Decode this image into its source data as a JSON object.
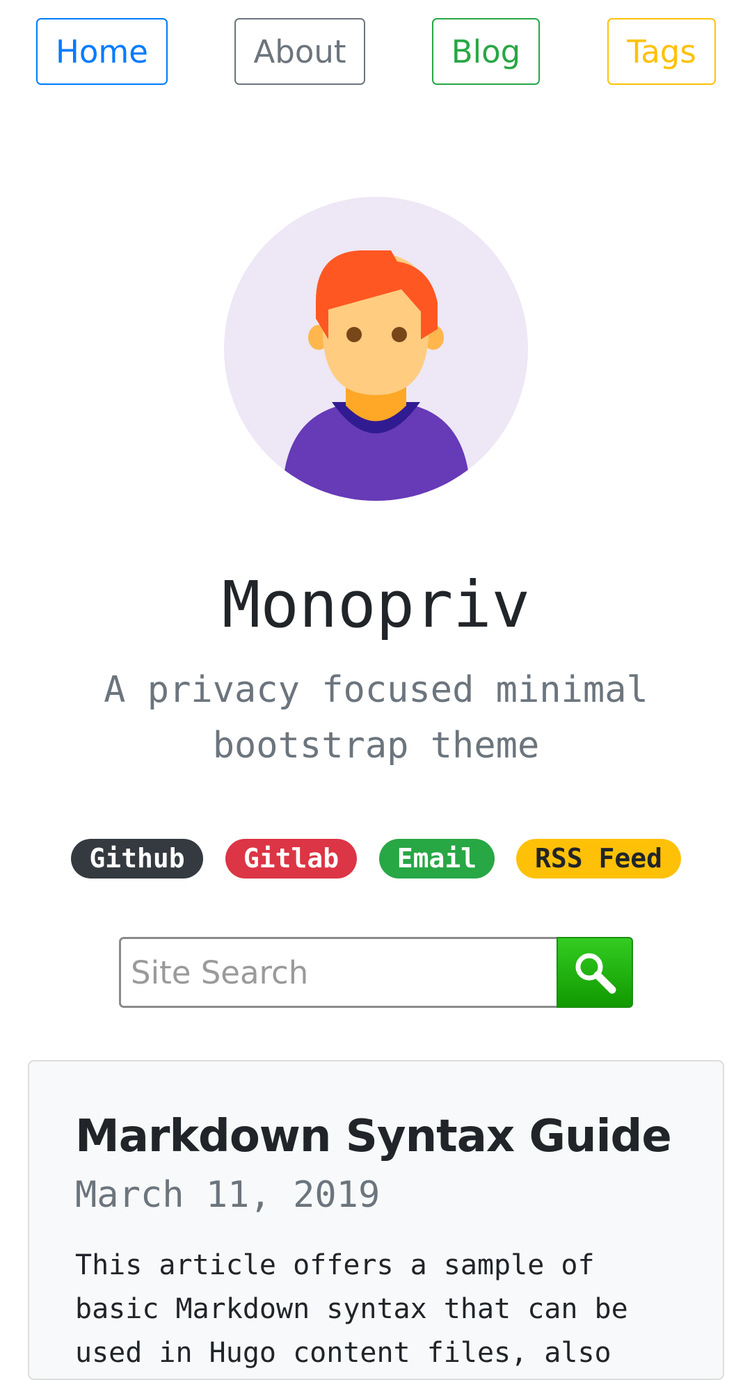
{
  "nav": {
    "items": [
      {
        "label": "Home"
      },
      {
        "label": "About"
      },
      {
        "label": "Blog"
      },
      {
        "label": "Tags"
      }
    ]
  },
  "profile": {
    "avatar_icon": "person-avatar-icon",
    "title": "Monopriv",
    "subtitle": "A privacy focused minimal bootstrap theme"
  },
  "social": {
    "badges": [
      {
        "label": "Github",
        "color": "#343a40"
      },
      {
        "label": "Gitlab",
        "color": "#dc3545"
      },
      {
        "label": "Email",
        "color": "#28a745"
      },
      {
        "label": "RSS Feed",
        "color": "#ffc107"
      }
    ]
  },
  "search": {
    "placeholder": "Site Search",
    "button_icon": "search-icon"
  },
  "post": {
    "title": "Markdown Syntax Guide",
    "date": "March 11, 2019",
    "excerpt": "This article offers a sample of basic Markdown syntax that can be used in Hugo content files, also"
  },
  "colors": {
    "primary": "#007bff",
    "secondary": "#6c757d",
    "success": "#28a745",
    "warning": "#ffc107"
  }
}
